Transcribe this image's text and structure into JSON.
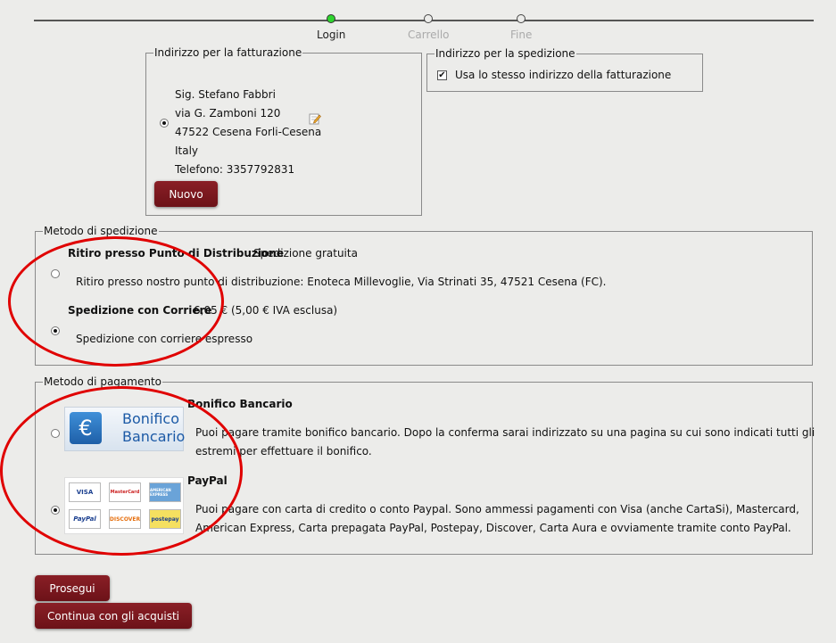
{
  "progress": {
    "steps": [
      {
        "label": "Login"
      },
      {
        "label": "Carrello"
      },
      {
        "label": "Fine"
      }
    ]
  },
  "billing": {
    "legend": "Indirizzo per la fatturazione",
    "lines": [
      "Sig. Stefano Fabbri",
      "via G. Zamboni 120",
      "47522 Cesena Forli-Cesena",
      "Italy",
      "Telefono: 3357792831"
    ],
    "new_button": "Nuovo",
    "edit_icon": "edit-icon"
  },
  "shipping_address": {
    "legend": "Indirizzo per la spedizione",
    "same_label": "Usa lo stesso indirizzo della fatturazione",
    "same_checked": true
  },
  "shipping_method": {
    "legend": "Metodo di spedizione",
    "options": [
      {
        "title": "Ritiro presso Punto di Distribuzione",
        "price": "Spedizione gratuita",
        "desc": "Ritiro presso nostro punto di distribuzione: Enoteca Millevoglie, Via Strinati 35, 47521 Cesena (FC).",
        "selected": false
      },
      {
        "title": "Spedizione con Corriere",
        "price": "6,05 € (5,00 € IVA esclusa)",
        "desc": "Spedizione con corriere espresso",
        "selected": true
      }
    ]
  },
  "payment_method": {
    "legend": "Metodo di pagamento",
    "options": [
      {
        "title": "Bonifico Bancario",
        "logo_line1": "Bonifico",
        "logo_line2": "Bancario",
        "desc1": "Puoi pagare tramite bonifico bancario. Dopo la conferma sarai indirizzato su una pagina su cui sono indicati tutti gli",
        "desc2": "estremi per effettuare il bonifico.",
        "selected": false
      },
      {
        "title": "PayPal",
        "desc1": "Puoi pagare con carta di credito o conto Paypal. Sono ammessi pagamenti con Visa (anche CartaSi), Mastercard,",
        "desc2": "American Express, Carta prepagata PayPal, Postepay, Discover, Carta Aura e ovviamente tramite conto PayPal.",
        "selected": true,
        "cards": [
          "VISA",
          "MasterCard",
          "AMERICAN EXPRESS",
          "PayPal",
          "DISCOVER",
          "postepay"
        ]
      }
    ]
  },
  "actions": {
    "continue": "Prosegui",
    "keep_shopping": "Continua con gli acquisti"
  },
  "colors": {
    "accent": "#7a1820",
    "annotation": "#e00000",
    "active_step": "#2fd52f"
  }
}
